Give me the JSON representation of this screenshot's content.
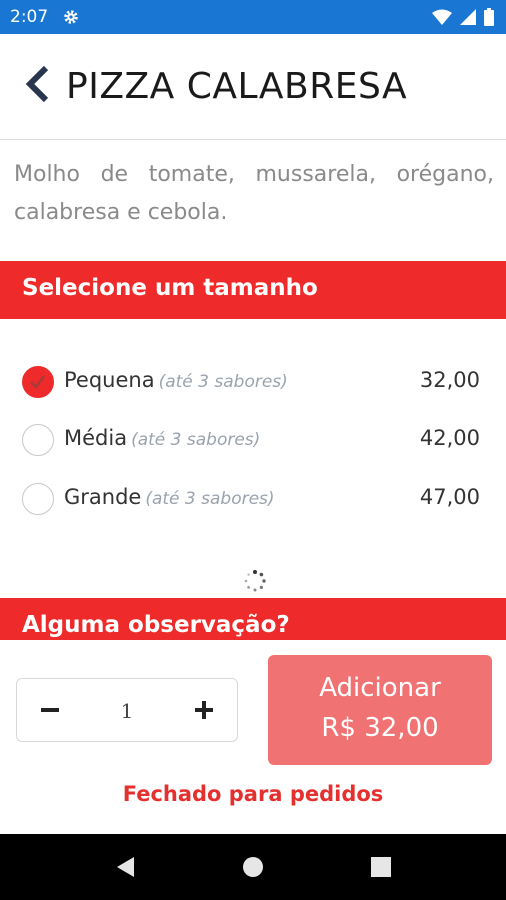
{
  "status_bar": {
    "time": "2:07"
  },
  "header": {
    "title": "PIZZA CALABRESA"
  },
  "description": "Molho de tomate, mussarela, orégano, calabresa e cebola.",
  "size_section": {
    "title": "Selecione um tamanho",
    "options": [
      {
        "label": "Pequena",
        "sub": "(até 3 sabores)",
        "price": "32,00",
        "selected": true
      },
      {
        "label": "Média",
        "sub": "(até 3 sabores)",
        "price": "42,00",
        "selected": false
      },
      {
        "label": "Grande",
        "sub": "(até 3 sabores)",
        "price": "47,00",
        "selected": false
      }
    ]
  },
  "observation_section": {
    "title": "Alguma observação?"
  },
  "order": {
    "quantity": "1",
    "add_label": "Adicionar",
    "add_price": "R$ 32,00",
    "closed_message": "Fechado para pedidos"
  },
  "colors": {
    "accent": "#ee2a2a",
    "status_bar": "#1976d2",
    "add_button": "#f07272"
  }
}
